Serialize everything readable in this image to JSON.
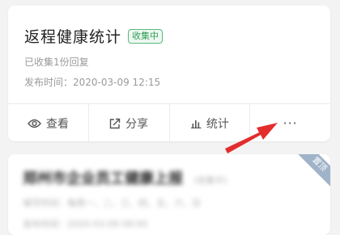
{
  "card1": {
    "title": "返程健康统计",
    "badge": "收集中",
    "collected": "已收集1份回复",
    "published": "发布时间：2020-03-09 12:15",
    "actions": {
      "view": "查看",
      "share": "分享",
      "stats": "统计",
      "more": "···"
    }
  },
  "card2": {
    "title": "郑州市企业员工健康上报",
    "subtitle": "(收集中)",
    "line1": "填写时间：每周一、二、三、四、五、六、日",
    "line2": "发布时间：2020-03-09 08:00",
    "ribbon": "置顶"
  },
  "colors": {
    "badge_green": "#2f9e57",
    "arrow_red": "#e32d2d",
    "background": "#f3f3f3"
  },
  "icons": [
    "eye-icon",
    "share-icon",
    "bar-chart-icon",
    "more-icon",
    "red-pointer-arrow"
  ]
}
